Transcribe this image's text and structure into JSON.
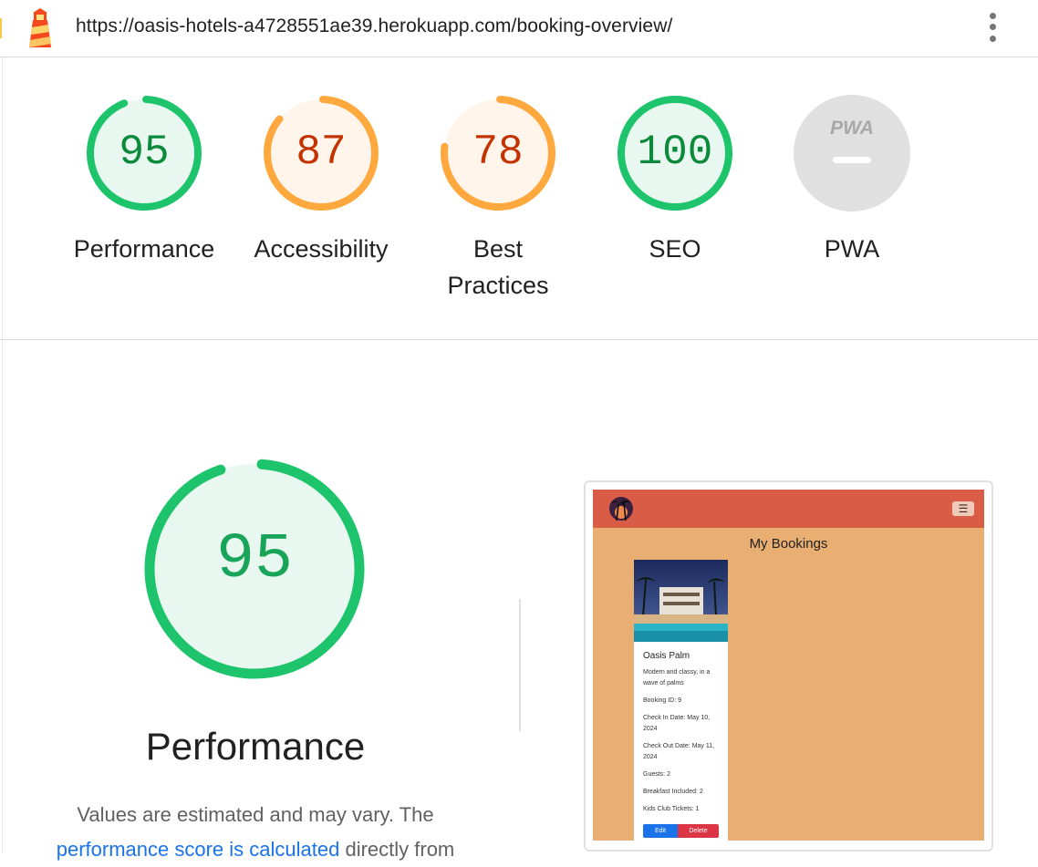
{
  "browser": {
    "url": "https://oasis-hotels-a4728551ae39.herokuapp.com/booking-overview/",
    "logo_icon": "lighthouse-icon",
    "menu_icon": "kebab-menu-icon"
  },
  "scores": [
    {
      "label": "Performance",
      "value": "95",
      "percent": 95,
      "status": "pass"
    },
    {
      "label": "Accessibility",
      "value": "87",
      "percent": 87,
      "status": "average"
    },
    {
      "label": "Best Practices",
      "value": "78",
      "percent": 78,
      "status": "average"
    },
    {
      "label": "SEO",
      "value": "100",
      "percent": 100,
      "status": "pass"
    },
    {
      "label": "PWA",
      "value": "PWA",
      "percent": 0,
      "status": "na"
    }
  ],
  "colors": {
    "pass_stroke": "#1dc46b",
    "pass_fill": "#e8f7ef",
    "pass_text": "#0a8a3a",
    "avg_stroke": "#ffa83e",
    "avg_fill": "#fff5ea",
    "avg_text": "#c33300",
    "na_fill": "#e0e0e0",
    "link": "#1a73e8"
  },
  "detail": {
    "score": "95",
    "percent": 95,
    "title": "Performance",
    "desc_prefix": "Values are estimated and may vary. The",
    "desc_link": "performance score is calculated",
    "desc_suffix": "directly from"
  },
  "screenshot": {
    "page_title": "My Bookings",
    "menu_icon": "hamburger-icon",
    "logo_icon": "palm-tree-logo-icon",
    "card": {
      "name": "Oasis Palm",
      "description": "Modern and classy, in a wave of palms",
      "booking_id": "Booking ID: 9",
      "check_in": "Check In Date: May 10, 2024",
      "check_out": "Check Out Date: May 11, 2024",
      "guests": "Guests: 2",
      "breakfast": "Breakfast Included: 2",
      "kids_club": "Kids Club Tickets: 1",
      "edit_label": "Edit",
      "delete_label": "Delete"
    }
  }
}
